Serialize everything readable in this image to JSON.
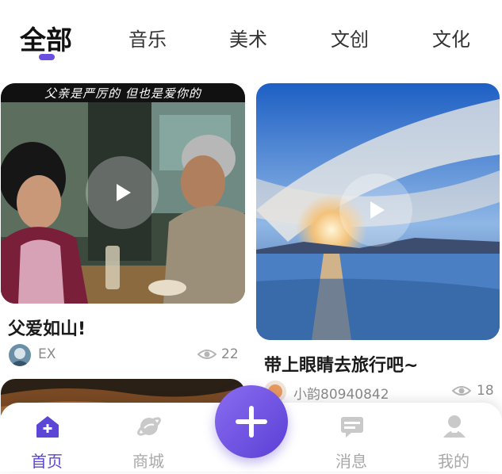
{
  "tabs": [
    {
      "label": "全部",
      "active": true
    },
    {
      "label": "音乐"
    },
    {
      "label": "美术"
    },
    {
      "label": "文创"
    },
    {
      "label": "文化"
    }
  ],
  "cards": [
    {
      "title": "父爱如山!",
      "overlay_text": "父亲是严厉的 但也是爱你的",
      "author": "EX",
      "views": "22"
    },
    {
      "title": "带上眼睛去旅行吧~",
      "author": "小韵80940842",
      "views": "18"
    }
  ],
  "bottom_nav": [
    {
      "label": "首页",
      "icon": "home-icon",
      "active": true
    },
    {
      "label": "商城",
      "icon": "planet-icon"
    },
    {
      "label": "消息",
      "icon": "message-icon"
    },
    {
      "label": "我的",
      "icon": "user-icon"
    }
  ],
  "fab": {
    "icon": "plus-icon"
  },
  "colors": {
    "accent": "#5b46d6",
    "inactive": "#a8a8a8",
    "fab_start": "#8a6df0",
    "fab_end": "#5b3fd6"
  }
}
